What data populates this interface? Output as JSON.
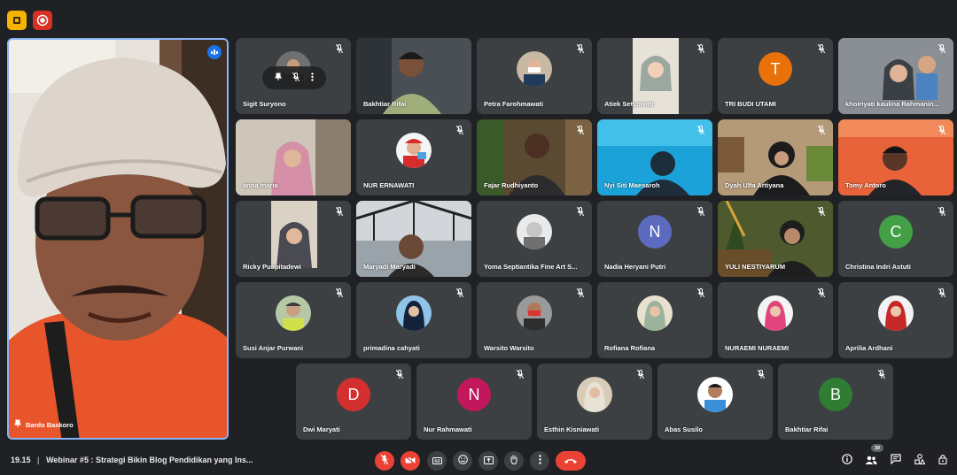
{
  "meeting": {
    "time": "19.15",
    "separator": "|",
    "title": "Webinar #5 : Strategi Bikin Blog Pendidikan yang Ins..."
  },
  "speaker": {
    "name": "Bardo Baskoro"
  },
  "participants": [
    {
      "name": "Sigit Suryono"
    },
    {
      "name": "Bakhtiar Rifai"
    },
    {
      "name": "Petra Farohmawati"
    },
    {
      "name": "Atiek Setyowati"
    },
    {
      "name": "TRI BUDI UTAMI",
      "initial": "T"
    },
    {
      "name": "khoiriyati kaulina Rahmanin..."
    },
    {
      "name": "anna maria"
    },
    {
      "name": "NUR ERNAWATI"
    },
    {
      "name": "Fajar Rudhiyanto"
    },
    {
      "name": "Nyi Siti Maesaroh"
    },
    {
      "name": "Dyah Ulfa Artiyana"
    },
    {
      "name": "Tomy Antoro"
    },
    {
      "name": "Ricky Puspitadewi"
    },
    {
      "name": "Maryadi Maryadi"
    },
    {
      "name": "Yoma Septiantika Fine Art S..."
    },
    {
      "name": "Nadia Heryani Putri",
      "initial": "N"
    },
    {
      "name": "YULI NESTIYARUM"
    },
    {
      "name": "Christina Indri Astuti",
      "initial": "C"
    },
    {
      "name": "Susi Anjar Purwani"
    },
    {
      "name": "primadina cahyati"
    },
    {
      "name": "Warsito Warsito"
    },
    {
      "name": "Rofiana Rofiana"
    },
    {
      "name": "NURAEMI NURAEMI"
    },
    {
      "name": "Aprilia Ardhani"
    },
    {
      "name": "Dwi Maryati",
      "initial": "D"
    },
    {
      "name": "Nur Rahmawati",
      "initial": "N"
    },
    {
      "name": "Esthin Kisniawati"
    },
    {
      "name": "Abas Susilo"
    },
    {
      "name": "Bakhtiar Rifai",
      "initial": "B"
    }
  ],
  "participant_count": "30",
  "colors": {
    "avatar_orange": "#e8710a",
    "avatar_purple": "#5c6bc0",
    "avatar_green": "#43a047",
    "avatar_red": "#d32f2f",
    "avatar_magenta": "#c2185b",
    "avatar_olive": "#2e7d32",
    "end_call": "#ea4335",
    "speaker_border": "#8ab4f8"
  },
  "icons": {
    "top_left": [
      "pin-icon",
      "record-icon"
    ],
    "controls": [
      "mic-off-icon",
      "camera-off-icon",
      "captions-icon",
      "emoji-icon",
      "present-icon",
      "raise-hand-icon",
      "more-options-icon",
      "end-call-icon"
    ],
    "right_controls": [
      "info-icon",
      "people-icon",
      "chat-icon",
      "activities-icon",
      "lock-icon"
    ]
  }
}
